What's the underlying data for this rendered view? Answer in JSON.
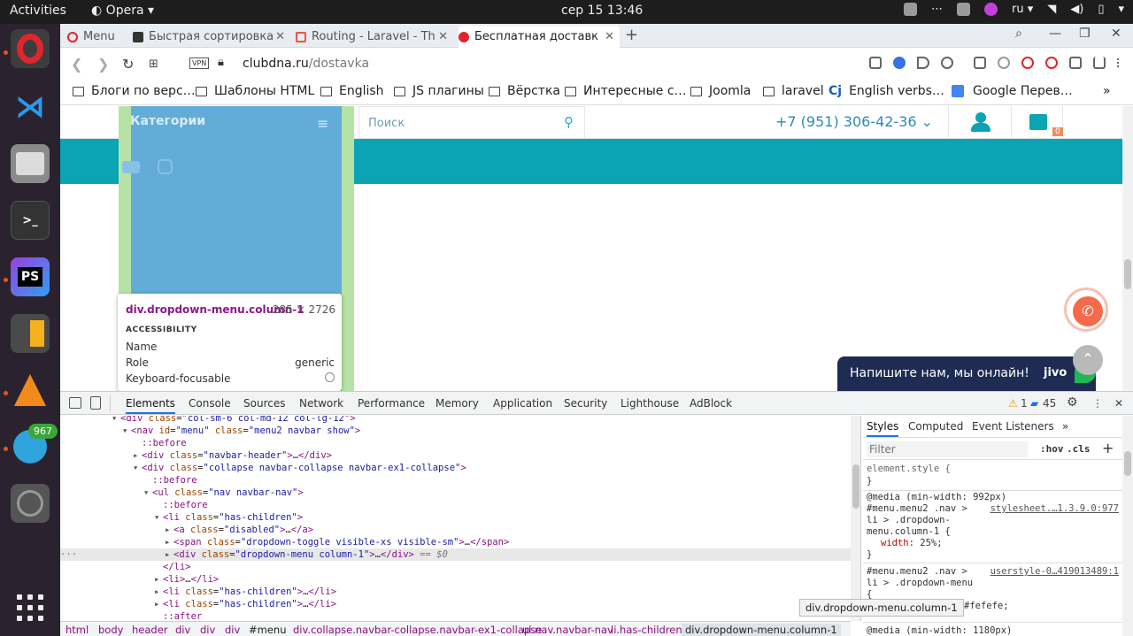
{
  "topbar": {
    "activities": "Activities",
    "app": "Opera ▾",
    "clock": "сер 15  13:46",
    "lang": "ru ▾"
  },
  "dock": {
    "telegram_badge": "967"
  },
  "browser": {
    "tabs": [
      {
        "label": "Menu",
        "color": "#e0252c"
      },
      {
        "label": "Быстрая сортировка",
        "color": "#333333"
      },
      {
        "label": "Routing - Laravel - Th",
        "color": "#f05340"
      },
      {
        "label": "Бесплатная доставк",
        "color": "#e0252c"
      }
    ],
    "new_tab": "+",
    "tab_close": "✕",
    "url_host": "clubdna.ru",
    "url_path": "/dostavka",
    "vpn": "VPN",
    "bookmarks": [
      "Блоги по верс…",
      "Шаблоны HTML",
      "English",
      "JS плагины",
      "Вёрстка",
      "Интересные с…",
      "Joomla",
      "laravel",
      "English verbs…",
      "Google Перев…"
    ],
    "bookmark_cj": "Cj",
    "bookmarks_more": "»"
  },
  "site": {
    "categories": "Категории",
    "search_placeholder": "Поиск",
    "phone": "+7 (951) 306-42-36 ⌄",
    "cart_count": "0",
    "jivo_text": "Напишите нам, мы онлайн!",
    "jivo_logo": "jivo",
    "up_arrow": "⌃"
  },
  "inspect_tooltip": {
    "element": "div.dropdown-menu.column-1",
    "size": "285 × 2726",
    "section": "ACCESSIBILITY",
    "name_label": "Name",
    "role_label": "Role",
    "role_value": "generic",
    "focus_label": "Keyboard-focusable"
  },
  "devtools": {
    "tabs": [
      "Elements",
      "Console",
      "Sources",
      "Network",
      "Performance",
      "Memory",
      "Application",
      "Security",
      "Lighthouse",
      "AdBlock"
    ],
    "warnings": "1",
    "messages": "45",
    "styles_tabs": [
      "Styles",
      "Computed",
      "Event Listeners"
    ],
    "styles_more": "»",
    "filter_placeholder": "Filter",
    "hov": ":hov",
    "cls": ".cls",
    "breadcrumbs": [
      "html",
      "body",
      "header",
      "div",
      "div",
      "div",
      "#menu",
      "div.collapse.navbar-collapse.navbar-ex1-collapse",
      "ul.nav.navbar-nav",
      "li.has-children",
      "div.dropdown-menu.column-1"
    ],
    "selection_hint": "div.dropdown-menu.column-1",
    "styles": {
      "element_style": "element.style {",
      "close": "}",
      "media1": "@media (min-width: 992px)",
      "rule1_a": "#menu.menu2 .nav >",
      "rule1_b": "li > .dropdown-",
      "rule1_c": "menu.column-1 {",
      "rule1_src": "stylesheet.…1.3.9.0:977",
      "rule1_prop": "width",
      "rule1_val": "25%;",
      "rule2_a": "#menu.menu2 .nav >",
      "rule2_b": "li > .dropdown-menu",
      "rule2_c": "{",
      "rule2_src": "userstyle-0…419013489:1",
      "rule2_val": "#fefefe;",
      "media2": "@media (min-width: 1180px)"
    }
  }
}
